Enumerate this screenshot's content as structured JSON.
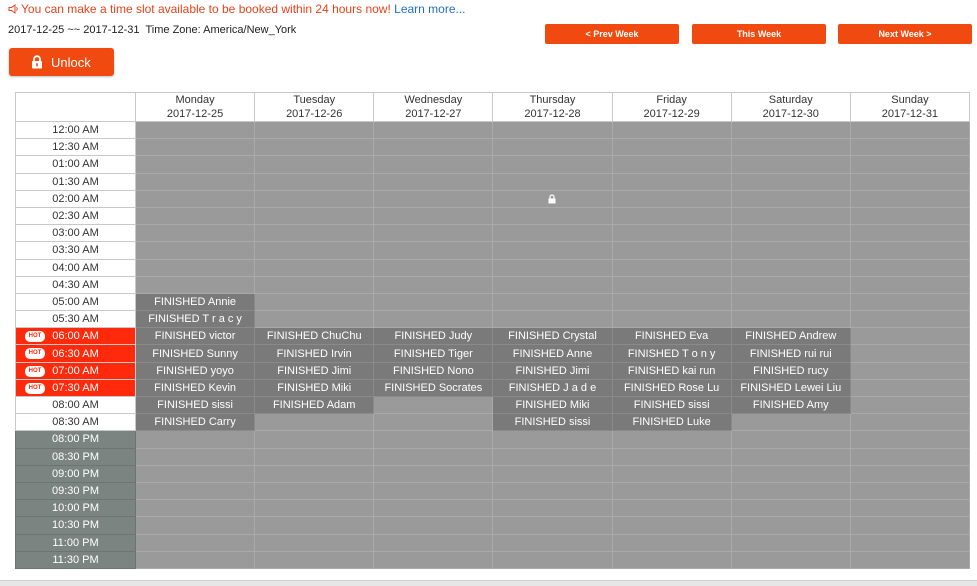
{
  "notice": {
    "text": "You can make a time slot available to be booked within 24 hours now!",
    "link": "Learn more..."
  },
  "range": {
    "dates": "2017-12-25 ~~ 2017-12-31",
    "timezone": "Time Zone: America/New_York"
  },
  "nav": {
    "prev": "< Prev Week",
    "this": "This Week",
    "next": "Next Week >"
  },
  "unlock": {
    "label": "Unlock",
    "icon": "lock-icon"
  },
  "colors": {
    "accent": "#f04a10",
    "hot": "#ff2a0b",
    "slot": "#9a9a9a",
    "booked": "#7a7a7a",
    "night": "#7c8482"
  },
  "days": [
    {
      "name": "Monday",
      "date": "2017-12-25"
    },
    {
      "name": "Tuesday",
      "date": "2017-12-26"
    },
    {
      "name": "Wednesday",
      "date": "2017-12-27"
    },
    {
      "name": "Thursday",
      "date": "2017-12-28"
    },
    {
      "name": "Friday",
      "date": "2017-12-29"
    },
    {
      "name": "Saturday",
      "date": "2017-12-30"
    },
    {
      "name": "Sunday",
      "date": "2017-12-31"
    }
  ],
  "hot_badge": "HOT",
  "times": [
    {
      "label": "12:00 AM",
      "type": "normal"
    },
    {
      "label": "12:30 AM",
      "type": "normal"
    },
    {
      "label": "01:00 AM",
      "type": "normal"
    },
    {
      "label": "01:30 AM",
      "type": "normal"
    },
    {
      "label": "02:00 AM",
      "type": "normal"
    },
    {
      "label": "02:30 AM",
      "type": "normal"
    },
    {
      "label": "03:00 AM",
      "type": "normal"
    },
    {
      "label": "03:30 AM",
      "type": "normal"
    },
    {
      "label": "04:00 AM",
      "type": "normal"
    },
    {
      "label": "04:30 AM",
      "type": "normal"
    },
    {
      "label": "05:00 AM",
      "type": "normal"
    },
    {
      "label": "05:30 AM",
      "type": "normal"
    },
    {
      "label": "06:00 AM",
      "type": "hot"
    },
    {
      "label": "06:30 AM",
      "type": "hot"
    },
    {
      "label": "07:00 AM",
      "type": "hot"
    },
    {
      "label": "07:30 AM",
      "type": "hot"
    },
    {
      "label": "08:00 AM",
      "type": "normal"
    },
    {
      "label": "08:30 AM",
      "type": "normal"
    },
    {
      "label": "08:00 PM",
      "type": "dark"
    },
    {
      "label": "08:30 PM",
      "type": "dark"
    },
    {
      "label": "09:00 PM",
      "type": "dark"
    },
    {
      "label": "09:30 PM",
      "type": "dark"
    },
    {
      "label": "10:00 PM",
      "type": "dark"
    },
    {
      "label": "10:30 PM",
      "type": "dark"
    },
    {
      "label": "11:00 PM",
      "type": "dark"
    },
    {
      "label": "11:30 PM",
      "type": "dark"
    }
  ],
  "bookings": {
    "10": [
      "FINISHED Annie",
      "",
      "",
      "",
      "",
      "",
      ""
    ],
    "11": [
      "FINISHED T r a c y",
      "",
      "",
      "",
      "",
      "",
      ""
    ],
    "12": [
      "FINISHED victor",
      "FINISHED ChuChu",
      "FINISHED Judy",
      "FINISHED Crystal",
      "FINISHED Eva",
      "FINISHED Andrew",
      ""
    ],
    "13": [
      "FINISHED Sunny",
      "FINISHED Irvin",
      "FINISHED Tiger",
      "FINISHED Anne",
      "FINISHED T o n y",
      "FINISHED rui rui",
      ""
    ],
    "14": [
      "FINISHED yoyo",
      "FINISHED Jimi",
      "FINISHED Nono",
      "FINISHED Jimi",
      "FINISHED kai run",
      "FINISHED rucy",
      ""
    ],
    "15": [
      "FINISHED Kevin",
      "FINISHED Miki",
      "FINISHED Socrates",
      "FINISHED J a d e",
      "FINISHED Rose Lu",
      "FINISHED Lewei Liu",
      ""
    ],
    "16": [
      "FINISHED sissi",
      "FINISHED Adam",
      "",
      "FINISHED Miki",
      "FINISHED sissi",
      "FINISHED Amy",
      ""
    ],
    "17": [
      "FINISHED Carry",
      "",
      "",
      "FINISHED sissi",
      "FINISHED Luke",
      "",
      ""
    ]
  }
}
